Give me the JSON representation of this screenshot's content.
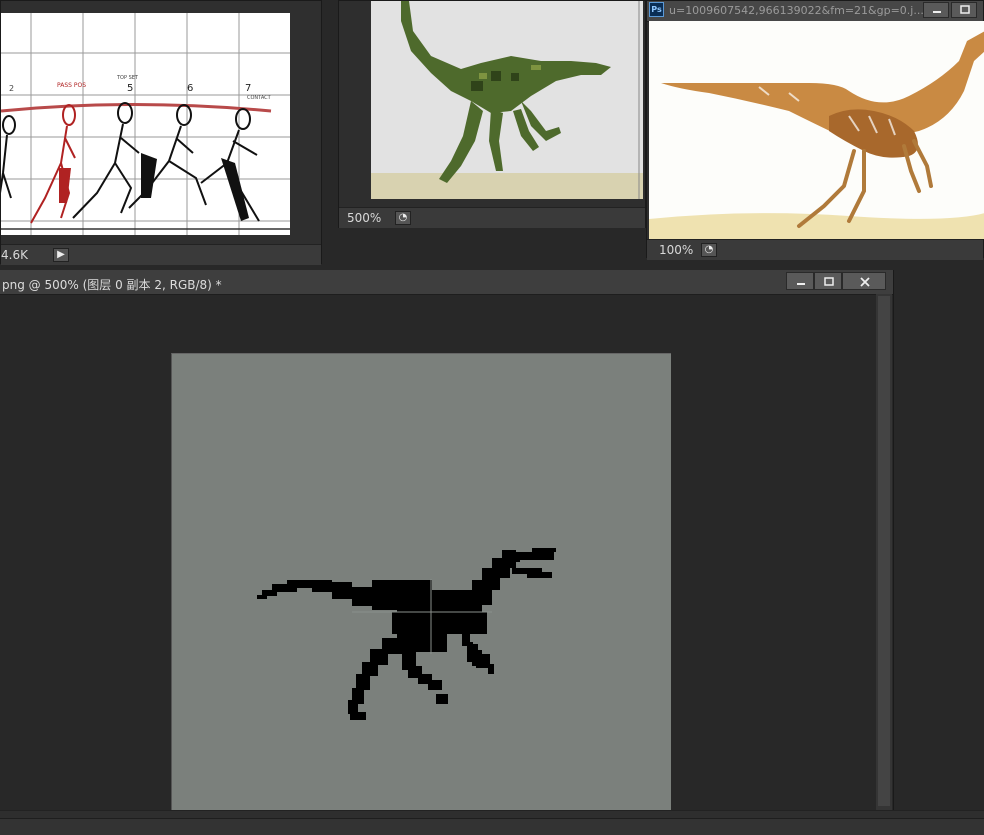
{
  "windows": {
    "run_cycle": {
      "size_text": "4.6K",
      "frame_labels": [
        "2",
        "5",
        "6",
        "7"
      ],
      "pass_label": "PASS POS",
      "top_label": "TOP SET",
      "contact_label": "CONTACT"
    },
    "green_dino": {
      "zoom": "500%"
    },
    "tan_dino": {
      "title": "u=1009607542,966139022&fm=21&gp=0.j...",
      "zoom": "100%",
      "ps_badge": "Ps"
    },
    "main": {
      "title": "png @ 500% (图层 0 副本 2, RGB/8) *"
    }
  },
  "colors": {
    "canvas_bg": "#7b807c",
    "workspace": "#282828",
    "panel": "#3a3a3a"
  }
}
